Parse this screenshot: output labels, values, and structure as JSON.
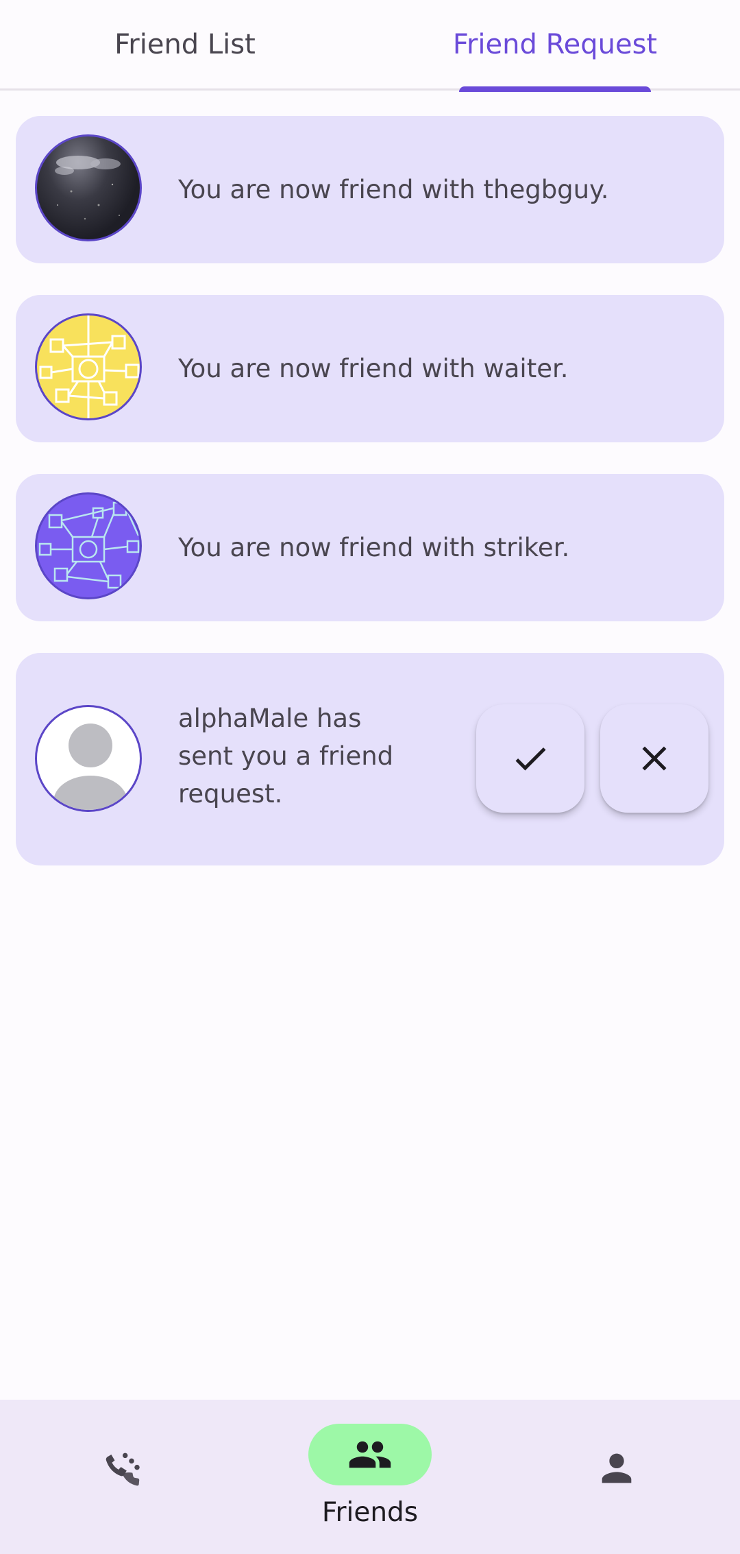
{
  "tabs": [
    {
      "label": "Friend List",
      "selected": false
    },
    {
      "label": "Friend Request",
      "selected": true
    }
  ],
  "notifications": [
    {
      "message": "You are now friend with thegbguy.",
      "avatar": "dark-photo"
    },
    {
      "message": "You are now friend with waiter.",
      "avatar": "yellow-network-pattern"
    },
    {
      "message": "You are now friend with striker.",
      "avatar": "purple-network-pattern"
    }
  ],
  "request": {
    "message": "alphaMale has sent you a friend request.",
    "avatar": "default-person",
    "accept_icon": "check-icon",
    "decline_icon": "close-icon"
  },
  "bottom_nav": {
    "items": [
      {
        "icon": "call-hangup-icon"
      },
      {
        "icon": "people-icon",
        "label": "Friends",
        "active": true
      },
      {
        "icon": "person-icon"
      }
    ]
  },
  "colors": {
    "accent": "#6a4ad9",
    "card_background": "#e5e0fb",
    "active_nav_pill": "#9df8a7"
  }
}
